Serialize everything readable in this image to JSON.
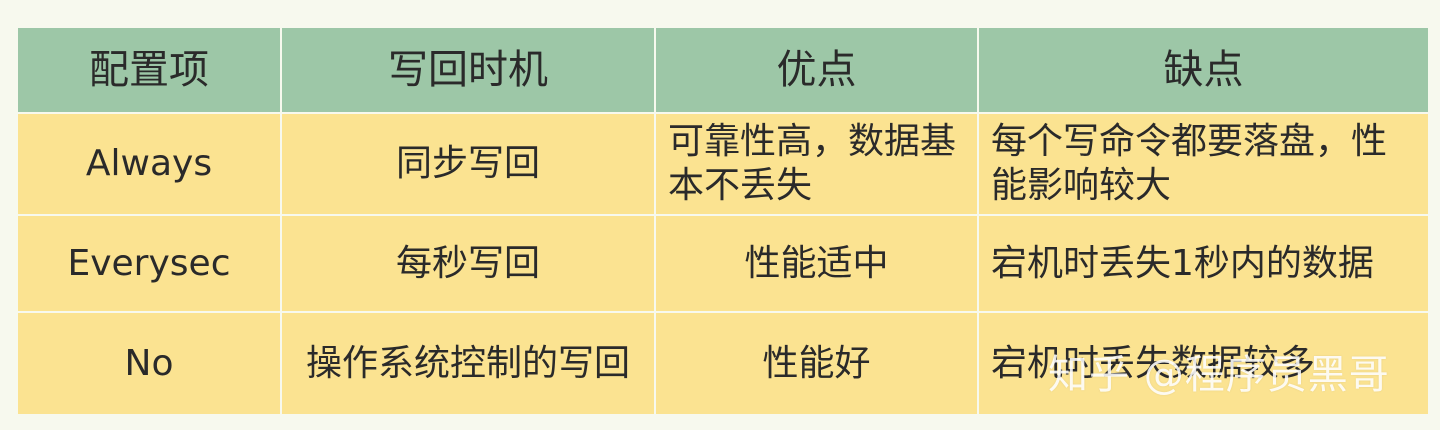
{
  "table": {
    "headers": [
      "配置项",
      "写回时机",
      "优点",
      "缺点"
    ],
    "rows": [
      [
        "Always",
        "同步写回",
        "可靠性高，数据基本不丢失",
        "每个写命令都要落盘，性能影响较大"
      ],
      [
        "Everysec",
        "每秒写回",
        "性能适中",
        "宕机时丢失1秒内的数据"
      ],
      [
        "No",
        "操作系统控制的写回",
        "性能好",
        "宕机时丢失数据较多"
      ]
    ]
  },
  "watermark": "知乎 @程序员黑哥",
  "colors": {
    "header_bg": "#9dc7a7",
    "row_bg": "#fbe391",
    "page_bg": "#f7f9ee"
  }
}
